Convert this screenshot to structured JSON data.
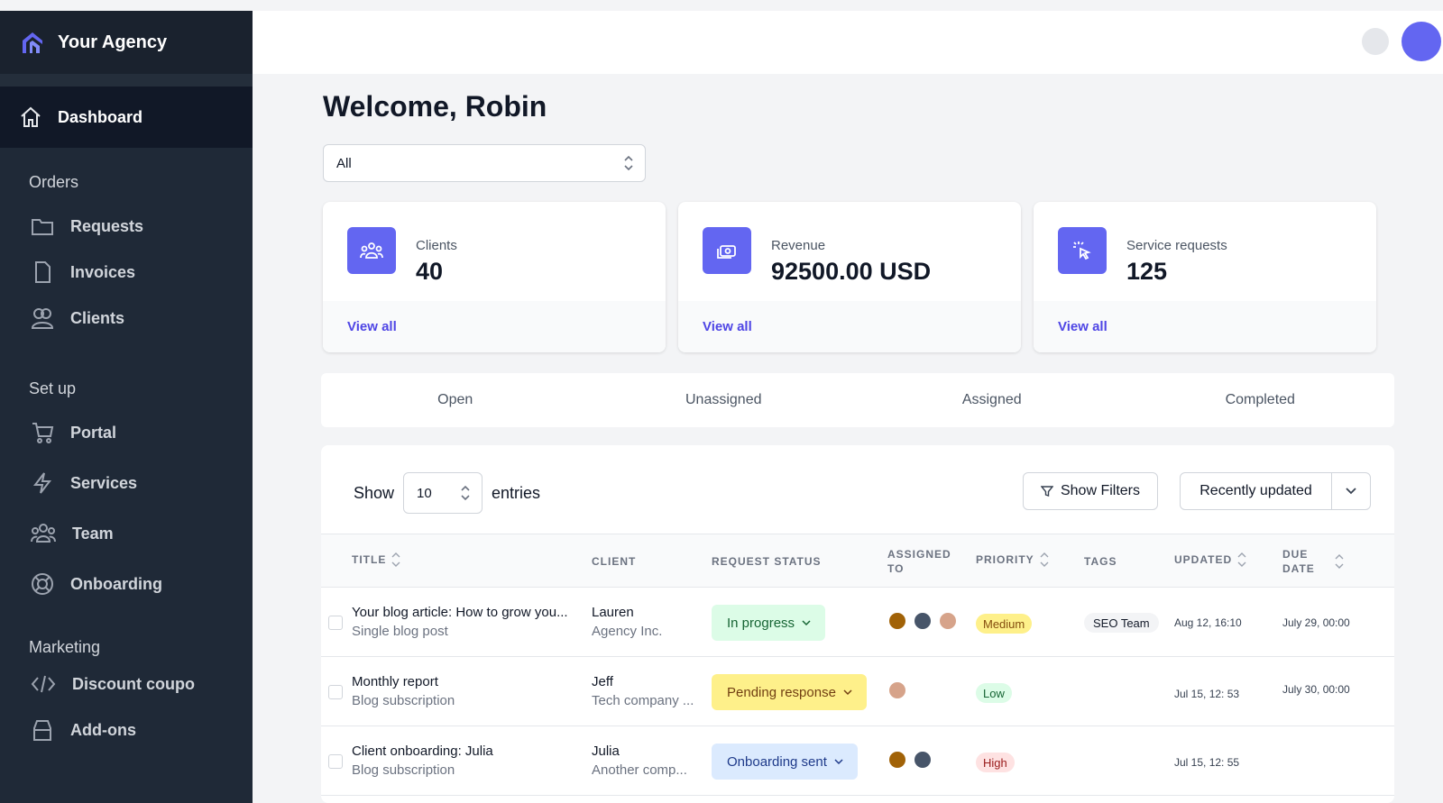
{
  "sidebar": {
    "brand": "Your Agency",
    "active": {
      "label": "Dashboard"
    },
    "sections": [
      {
        "title": "Orders",
        "items": [
          {
            "label": "Requests"
          },
          {
            "label": "Invoices"
          },
          {
            "label": "Clients"
          }
        ]
      },
      {
        "title": "Set up",
        "items": [
          {
            "label": "Portal"
          },
          {
            "label": "Services"
          },
          {
            "label": "Team"
          },
          {
            "label": "Onboarding"
          }
        ]
      },
      {
        "title": "Marketing",
        "items": [
          {
            "label": "Discount coupo"
          },
          {
            "label": "Add-ons"
          }
        ]
      }
    ]
  },
  "main": {
    "welcome": "Welcome, Robin",
    "filter_value": "All",
    "cards": [
      {
        "label": "Clients",
        "value": "40",
        "link": "View all"
      },
      {
        "label": "Revenue",
        "value": "92500.00 USD",
        "link": "View all"
      },
      {
        "label": "Service requests",
        "value": "125",
        "link": "View all"
      }
    ],
    "tabs": [
      "Open",
      "Unassigned",
      "Assigned",
      "Completed"
    ]
  },
  "table": {
    "show_label": "Show",
    "entries_value": "10",
    "entries_label": "entries",
    "filters_button": "Show Filters",
    "sort_label": "Recently updated",
    "headers": {
      "title": "TITLE",
      "client": "CLIENT",
      "status": "REQUEST STATUS",
      "assigned_1": "ASSIGNED",
      "assigned_2": "TO",
      "priority": "PRIORITY",
      "tags": "TAGS",
      "updated": "UPDATED",
      "due_1": "DUE",
      "due_2": "DATE"
    },
    "rows": [
      {
        "title": "Your blog article: How to grow you...",
        "subtitle": "Single blog post",
        "client": "Lauren",
        "company": "Agency Inc.",
        "status": "In progress",
        "priority": "Medium",
        "tag": "SEO Team",
        "updated": "Aug 12, 16:10",
        "due": "July 29, 00:00"
      },
      {
        "title": "Monthly report",
        "subtitle": "Blog subscription",
        "client": "Jeff",
        "company": "Tech company ...",
        "status": "Pending response",
        "priority": "Low",
        "tag": "",
        "updated": "Jul 15, 12: 53",
        "due": "July 30, 00:00"
      },
      {
        "title": "Client onboarding: Julia",
        "subtitle": "Blog subscription",
        "client": "Julia",
        "company": "Another comp...",
        "status": "Onboarding sent",
        "priority": "High",
        "tag": "",
        "updated": "Jul 15, 12: 55",
        "due": ""
      }
    ]
  },
  "colors": {
    "sidebar_bg": "#1f2937",
    "accent": "#6366f1",
    "link": "#4f46e5",
    "status_in_progress": "#dcfce7",
    "status_pending": "#fef08a",
    "status_onboarding": "#dbeafe",
    "priority_medium": "#fef08a",
    "priority_low": "#dcfce7",
    "priority_high": "#fee2e2"
  }
}
